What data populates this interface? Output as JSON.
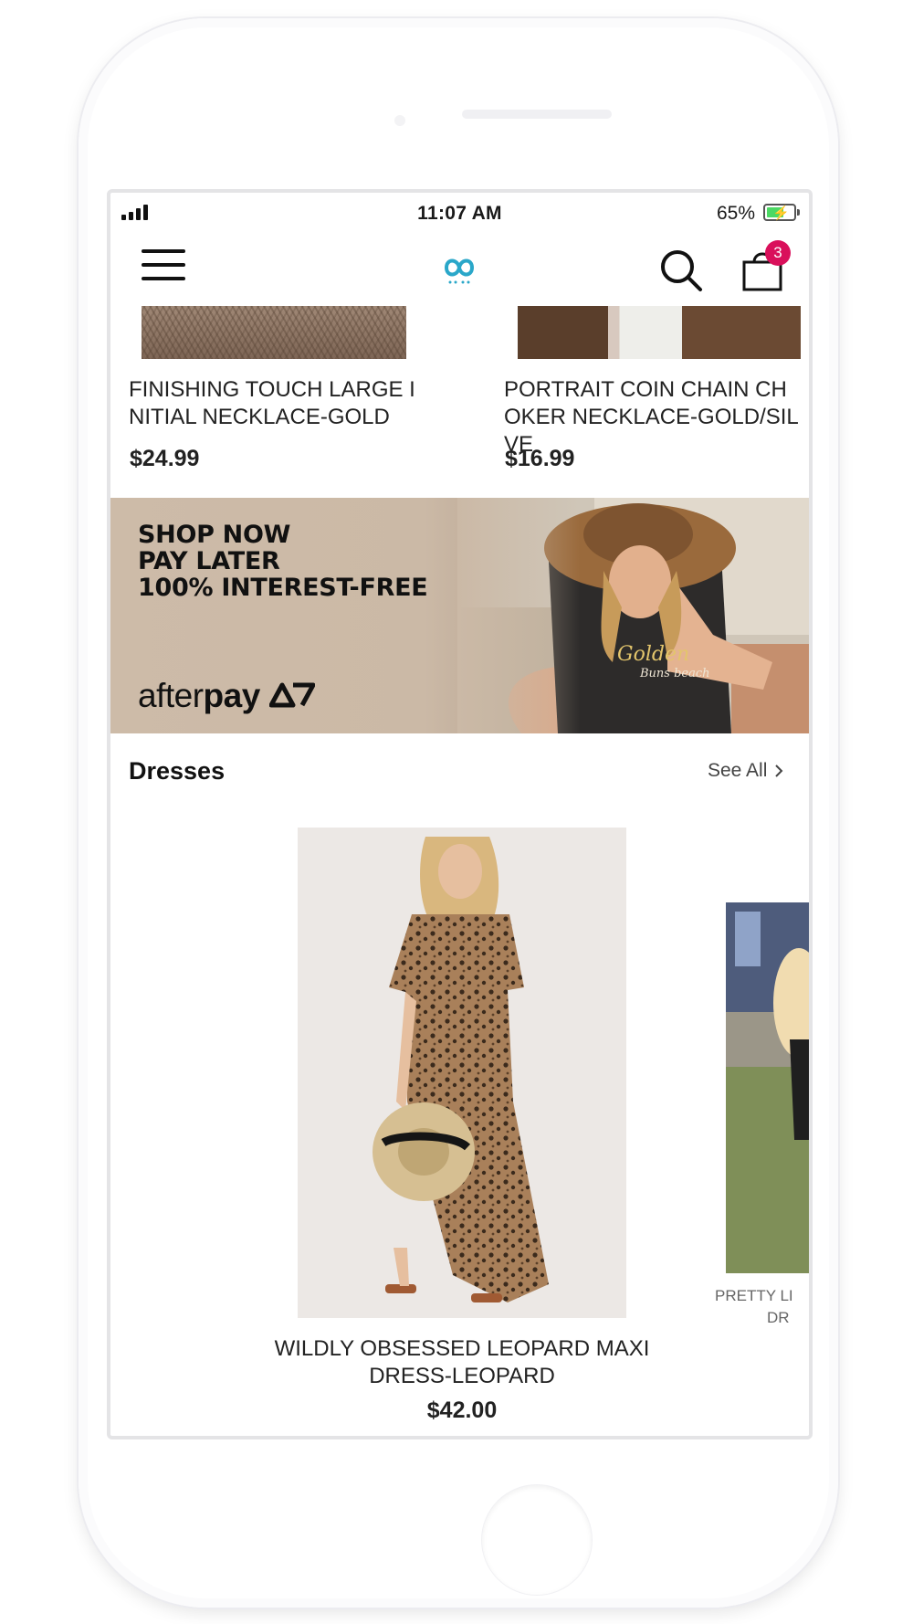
{
  "status_bar": {
    "time": "11:07 AM",
    "battery_percent": "65%",
    "battery_level": 0.65,
    "signal_bars": 4
  },
  "header": {
    "menu_icon": "hamburger-menu-icon",
    "logo_icon": "brand-logo-icon",
    "search_icon": "search-icon",
    "bag_icon": "shopping-bag-icon",
    "cart_count": "3",
    "badge_color": "#d9105b"
  },
  "products_top": [
    {
      "title": "FINISHING TOUCH LARGE INITIAL NECKLACE-GOLD",
      "price": "$24.99"
    },
    {
      "title": "PORTRAIT COIN CHAIN CHOKER NECKLACE-GOLD/SILVE",
      "price": "$16.99"
    }
  ],
  "banner": {
    "lines": [
      "SHOP NOW",
      "PAY LATER",
      "100% INTEREST-FREE"
    ],
    "brand_prefix": "after",
    "brand_suffix": "pay",
    "shirt_text": "Golden Buns beach",
    "background_color": "#cdbba8"
  },
  "section": {
    "title": "Dresses",
    "see_all": "See All"
  },
  "dresses": [
    {
      "title": "WILDLY OBSESSED LEOPARD MAXI DRESS-LEOPARD",
      "price": "$42.00"
    },
    {
      "title_peek_line1": "PRETTY LI",
      "title_peek_line2": "DR"
    }
  ]
}
